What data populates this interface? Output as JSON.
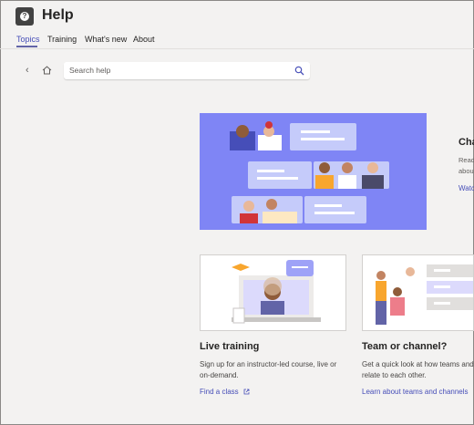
{
  "app": {
    "title": "Help",
    "icon": "question-icon"
  },
  "tabs": [
    {
      "label": "Topics",
      "active": true
    },
    {
      "label": "Training",
      "active": false
    },
    {
      "label": "What's new",
      "active": false
    },
    {
      "label": "About",
      "active": false
    }
  ],
  "search": {
    "placeholder": "Search help"
  },
  "hero": {
    "title": "Cha",
    "desc_line1": "Read",
    "desc_line2": "abou",
    "link": "Watc"
  },
  "cards": [
    {
      "title": "Live training",
      "desc_line1": "Sign up for an instructor-led course, live or",
      "desc_line2": "on-demand.",
      "link": "Find a class"
    },
    {
      "title": "Team or channel?",
      "desc_line1": "Get a quick look at how teams and",
      "desc_line2": "relate to each other.",
      "link": "Learn about teams and channels"
    }
  ],
  "colors": {
    "accent": "#6264a7",
    "link": "#464eb8",
    "hero_bg": "#7f85f5"
  }
}
